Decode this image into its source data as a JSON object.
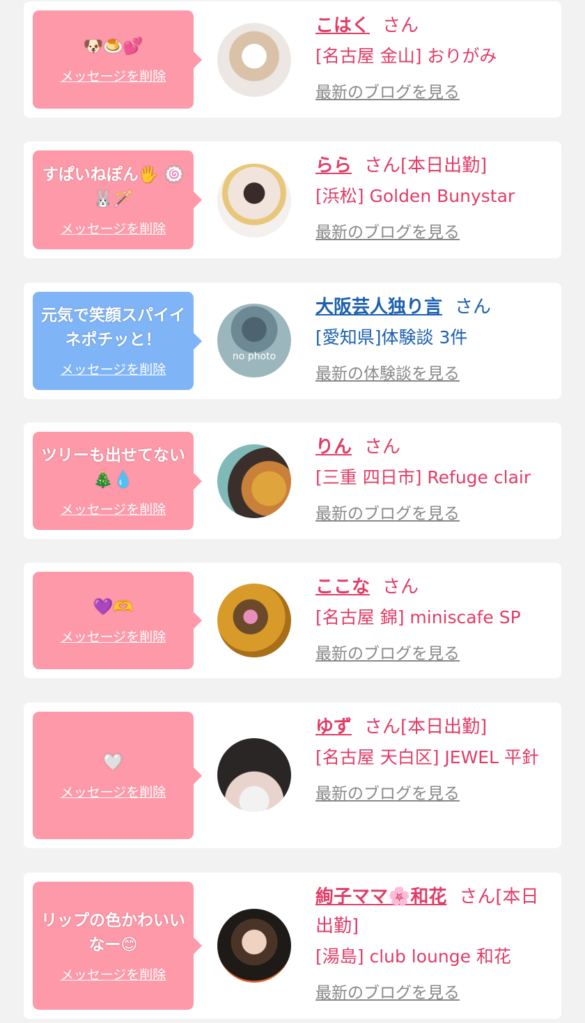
{
  "delete_label": "メッセージを削除",
  "san_suffix": "さん",
  "cards": [
    {
      "message": "🐶🍮💕",
      "name": "こはく",
      "status": "",
      "shop": "[名古屋 金山] おりがみ",
      "link": "最新のブログを見る"
    },
    {
      "message": "すぱいねぽん🖐 🍥🐰🪄",
      "name": "らら",
      "status": "[本日出勤]",
      "shop": "[浜松] Golden Bunystar",
      "link": "最新のブログを見る"
    },
    {
      "message": "元気で笑顔スパイイネポチッと！",
      "name": "大阪芸人独り言",
      "status": "",
      "shop": "[愛知県]体験談 3件",
      "link": "最新の体験談を見る",
      "avatar_text": "no photo"
    },
    {
      "message": "ツリーも出せてない🎄💧",
      "name": "りん",
      "status": "",
      "shop": "[三重 四日市] Refuge clair",
      "link": "最新のブログを見る"
    },
    {
      "message": "💜🫶",
      "name": "ここな",
      "status": "",
      "shop": "[名古屋 錦] miniscafe SP",
      "link": "最新のブログを見る"
    },
    {
      "message": "🤍",
      "name": "ゆず",
      "status": "[本日出勤]",
      "shop": "[名古屋 天白区] JEWEL 平針",
      "link": "最新のブログを見る"
    },
    {
      "message": "リップの色かわいいなー😊",
      "name": "絢子ママ🌸和花",
      "status": "[本日出勤]",
      "shop": "[湯島] club lounge 和花",
      "link": "最新のブログを見る"
    }
  ],
  "colors": {
    "pink_bubble": "#fe99a9",
    "blue_bubble": "#7fb4f7",
    "name_pink": "#e23b66",
    "name_blue": "#1a5fb0",
    "link_gray": "#888888",
    "page_bg": "#f2f2f2"
  }
}
